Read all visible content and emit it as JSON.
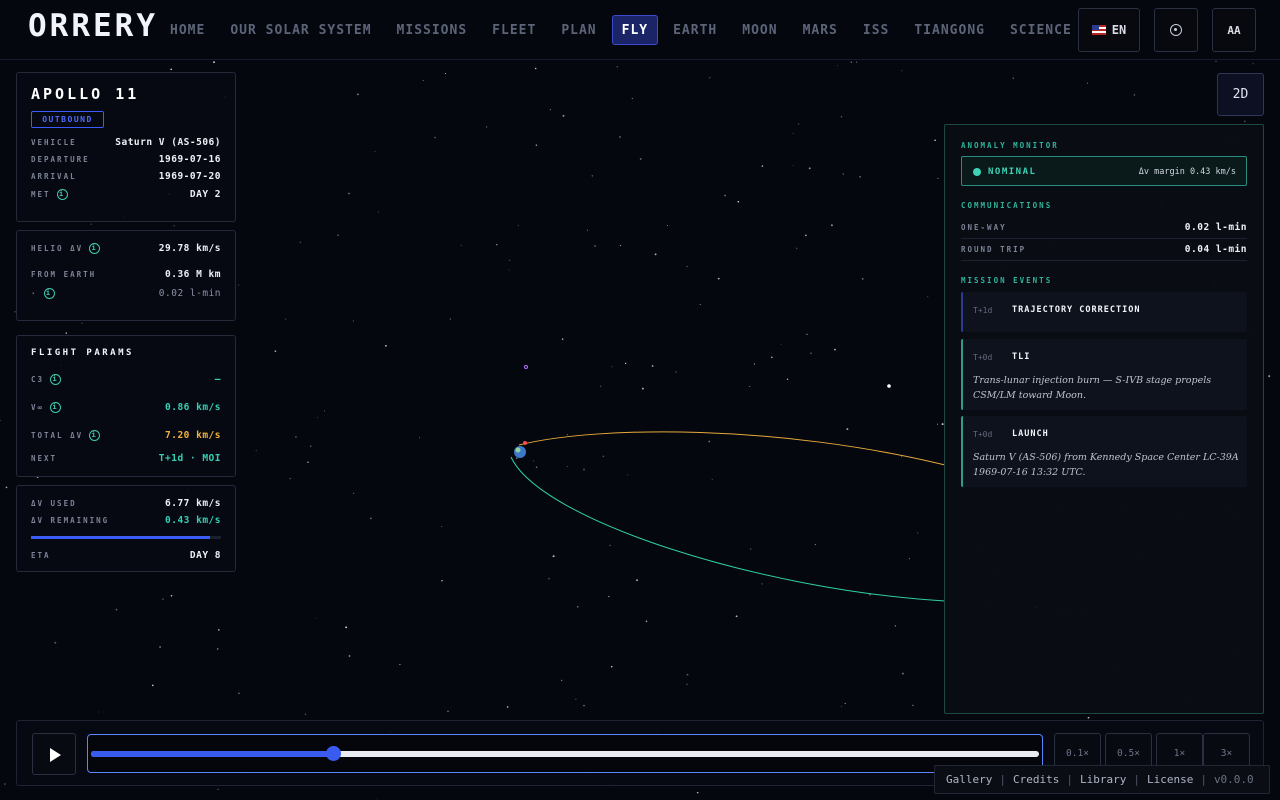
{
  "app": {
    "logo": "ORRERY"
  },
  "nav": {
    "items": [
      "HOME",
      "OUR SOLAR SYSTEM",
      "MISSIONS",
      "FLEET",
      "PLAN",
      "FLY",
      "EARTH",
      "MOON",
      "MARS",
      "ISS",
      "TIANGONG",
      "SCIENCE"
    ],
    "active": "FLY"
  },
  "header": {
    "language": "EN",
    "flag_icon": "us-flag-icon",
    "target_icon": "target-icon",
    "font_size_button": "AA"
  },
  "mission": {
    "name": "APOLLO 11",
    "status": "OUTBOUND",
    "vehicle_label": "VEHICLE",
    "vehicle": "Saturn V (AS-506)",
    "departure_label": "DEPARTURE",
    "departure": "1969-07-16",
    "arrival_label": "ARRIVAL",
    "arrival": "1969-07-20",
    "met_label": "MET",
    "met": "DAY 2"
  },
  "kinematics": {
    "helio_label": "HELIO ΔV",
    "helio": "29.78 km/s",
    "from_earth_label": "FROM EARTH",
    "from_earth": "0.36 M km",
    "light_label": "·",
    "light": "0.02 l-min"
  },
  "flight_params": {
    "title": "FLIGHT PARAMS",
    "c3_label": "C3",
    "c3": "—",
    "vinf_label": "V∞",
    "vinf": "0.86 km/s",
    "total_dv_label": "TOTAL ΔV",
    "total_dv": "7.20 km/s",
    "next_label": "NEXT",
    "next": "T+1d · MOI"
  },
  "budget": {
    "used_label": "ΔV USED",
    "used": "6.77 km/s",
    "remaining_label": "ΔV REMAINING",
    "remaining": "0.43 km/s",
    "used_fraction": 0.94,
    "eta_label": "ETA",
    "eta": "DAY 8"
  },
  "view_toggle": "2D",
  "anomaly": {
    "title": "ANOMALY MONITOR",
    "status": "NOMINAL",
    "margin": "Δv margin 0.43 km/s",
    "status_color": "#3ed3b6"
  },
  "communications": {
    "title": "COMMUNICATIONS",
    "one_way_label": "ONE-WAY",
    "one_way": "0.02 l-min",
    "round_trip_label": "ROUND TRIP",
    "round_trip": "0.04 l-min"
  },
  "events": {
    "title": "MISSION EVENTS",
    "items": [
      {
        "t": "T+1d",
        "title": "TRAJECTORY CORRECTION",
        "desc": ""
      },
      {
        "t": "T+0d",
        "title": "TLI",
        "desc": "Trans-lunar injection burn — S-IVB stage propels CSM/LM toward Moon."
      },
      {
        "t": "T+0d",
        "title": "LAUNCH",
        "desc": "Saturn V (AS-506) from Kennedy Space Center LC-39A 1969-07-16 13:32 UTC."
      }
    ]
  },
  "timeline": {
    "progress": 0.255,
    "speeds": [
      "0.1×",
      "0.5×",
      "1×",
      "3×"
    ],
    "play_icon": "play-icon"
  },
  "footer": {
    "links": [
      "Gallery",
      "Credits",
      "Library",
      "License"
    ],
    "version": "v0.0.0"
  },
  "colors": {
    "accent": "#3a5bf0",
    "outbound_path": "#f3b23a",
    "return_path": "#2fcfa6",
    "panel_border": "#1d4a46"
  }
}
